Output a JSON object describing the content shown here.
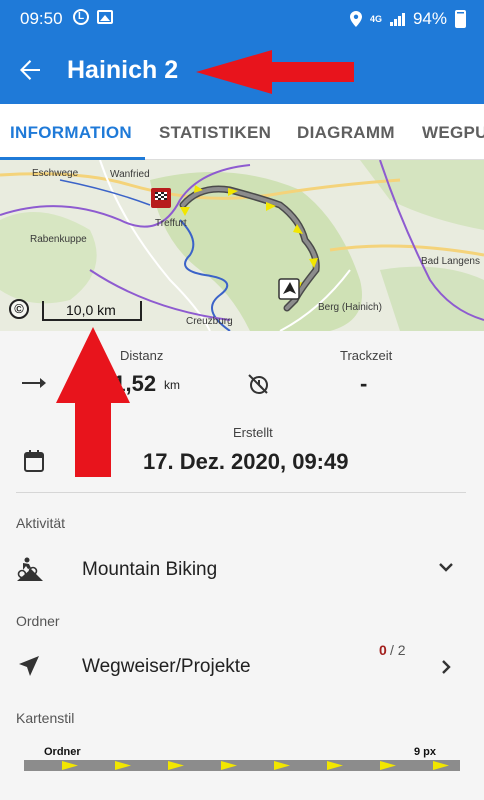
{
  "status_bar": {
    "time": "09:50",
    "l_badge": "L",
    "network": "4G",
    "battery": "94%"
  },
  "app_bar": {
    "title": "Hainich 2"
  },
  "tabs": [
    {
      "label": "INFORMATION",
      "active": true
    },
    {
      "label": "STATISTIKEN",
      "active": false
    },
    {
      "label": "DIAGRAMM",
      "active": false
    },
    {
      "label": "WEGPU",
      "active": false
    }
  ],
  "map": {
    "labels": [
      "Eschwege",
      "Wanfried",
      "Treffurt",
      "Rabenkuppe",
      "Creuzburg",
      "Bad Langens",
      "Berg (Hainich)"
    ],
    "scale": "10,0 km",
    "copyright_symbol": "©"
  },
  "stats": {
    "distance_label": "Distanz",
    "distance_value": "41,52",
    "distance_unit": "km",
    "tracktime_label": "Trackzeit",
    "tracktime_value": "-",
    "created_label": "Erstellt",
    "created_value": "17. Dez. 2020, 09:49"
  },
  "activity": {
    "section_label": "Aktivität",
    "value": "Mountain Biking",
    "icon": "mountain-biker-icon"
  },
  "folder": {
    "section_label": "Ordner",
    "value": "Wegweiser/Projekte",
    "count_current": "0",
    "count_total": "/ 2",
    "icon": "navigation-arrow-icon"
  },
  "map_style": {
    "section_label": "Kartenstil",
    "left_label": "Ordner",
    "right_label": "9 px"
  },
  "colors": {
    "primary": "#1f7ad8",
    "annotation_red": "#e8141c",
    "count_red": "#a3201d",
    "track_yellow": "#f2e600",
    "track_gray": "#8c8c8c"
  }
}
